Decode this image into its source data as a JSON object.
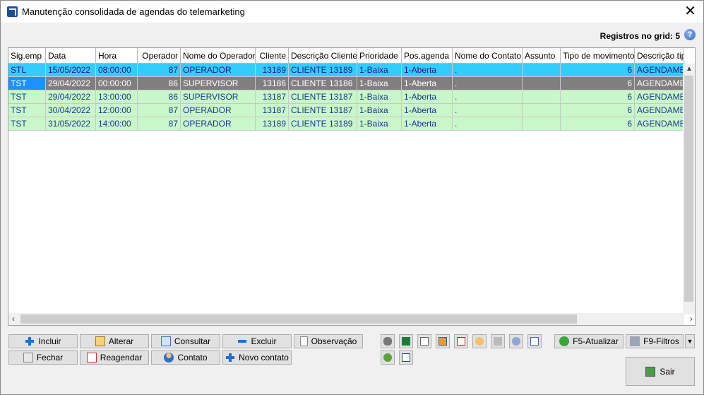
{
  "window": {
    "title": "Manutenção consolidada de agendas do telemarketing",
    "close_glyph": "✕"
  },
  "status": {
    "registros": "Registros no grid: 5",
    "help_glyph": "?"
  },
  "grid": {
    "headers": [
      "Sig.emp",
      "Data",
      "Hora",
      "Operador",
      "Nome do Operador",
      "Cliente",
      "Descrição Cliente",
      "Prioridade",
      "Pos.agenda",
      "Nome do Contato",
      "Assunto",
      "Tipo de movimento",
      "Descrição tip"
    ],
    "rows": [
      [
        "STL",
        "15/05/2022",
        "08:00:00",
        "87",
        "OPERADOR",
        "13189",
        "CLIENTE 13189",
        "1-Baixa",
        "1-Aberta",
        ".",
        "",
        "6",
        "AGENDAMENT"
      ],
      [
        "TST",
        "29/04/2022",
        "00:00:00",
        "86",
        "SUPERVISOR",
        "13186",
        "CLIENTE 13186",
        "1-Baixa",
        "1-Aberta",
        ".",
        "",
        "6",
        "AGENDAMENT"
      ],
      [
        "TST",
        "29/04/2022",
        "13:00:00",
        "86",
        "SUPERVISOR",
        "13187",
        "CLIENTE 13187",
        "1-Baixa",
        "1-Aberta",
        ".",
        "",
        "6",
        "AGENDAMENT"
      ],
      [
        "TST",
        "30/04/2022",
        "12:00:00",
        "87",
        "OPERADOR",
        "13187",
        "CLIENTE 13187",
        "1-Baixa",
        "1-Aberta",
        ".",
        "",
        "6",
        "AGENDAMENT"
      ],
      [
        "TST",
        "31/05/2022",
        "14:00:00",
        "87",
        "OPERADOR",
        "13189",
        "CLIENTE 13189",
        "1-Baixa",
        "1-Aberta",
        ".",
        "",
        "6",
        "AGENDAMENT"
      ]
    ]
  },
  "buttons": {
    "incluir": "Incluir",
    "alterar": "Alterar",
    "consultar": "Consultar",
    "excluir": "Excluir",
    "observacao": "Observação",
    "fechar": "Fechar",
    "reagendar": "Reagendar",
    "contato": "Contato",
    "novo_contato": "Novo contato",
    "f5": "F5-Atualizar",
    "f9": "F9-Filtros",
    "sair": "Sair"
  },
  "colors": {
    "selected_row": "#33ccff",
    "focus_row": "#7f7f7f",
    "normal_row": "#c9f7c9"
  }
}
